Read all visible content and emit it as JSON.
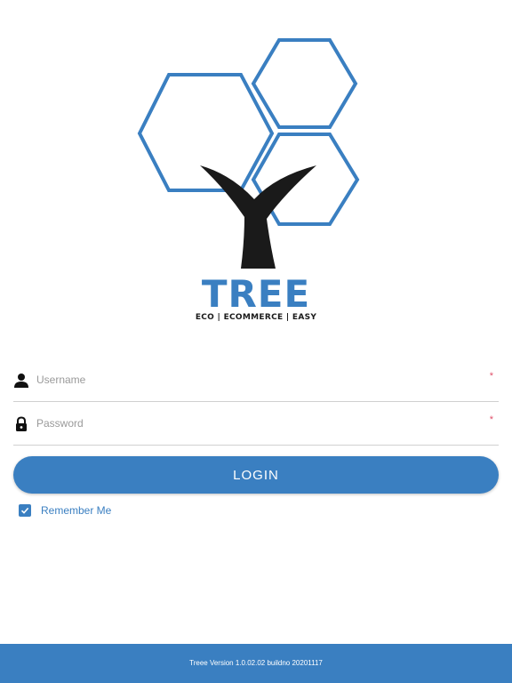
{
  "brand": {
    "name": "TREE",
    "tagline": "ECO | ECOMMERCE | EASY",
    "primary_color": "#3a7fc1",
    "trunk_color": "#1a1a1a"
  },
  "form": {
    "username": {
      "icon": "user-icon",
      "placeholder": "Username",
      "value": "",
      "required_mark": "*"
    },
    "password": {
      "icon": "lock-icon",
      "placeholder": "Password",
      "value": "",
      "required_mark": "*"
    },
    "login_label": "LOGIN",
    "remember_me": {
      "label": "Remember Me",
      "checked": true
    }
  },
  "footer": {
    "version_text": "Treee Version 1.0.02.02 buildno 20201117"
  }
}
